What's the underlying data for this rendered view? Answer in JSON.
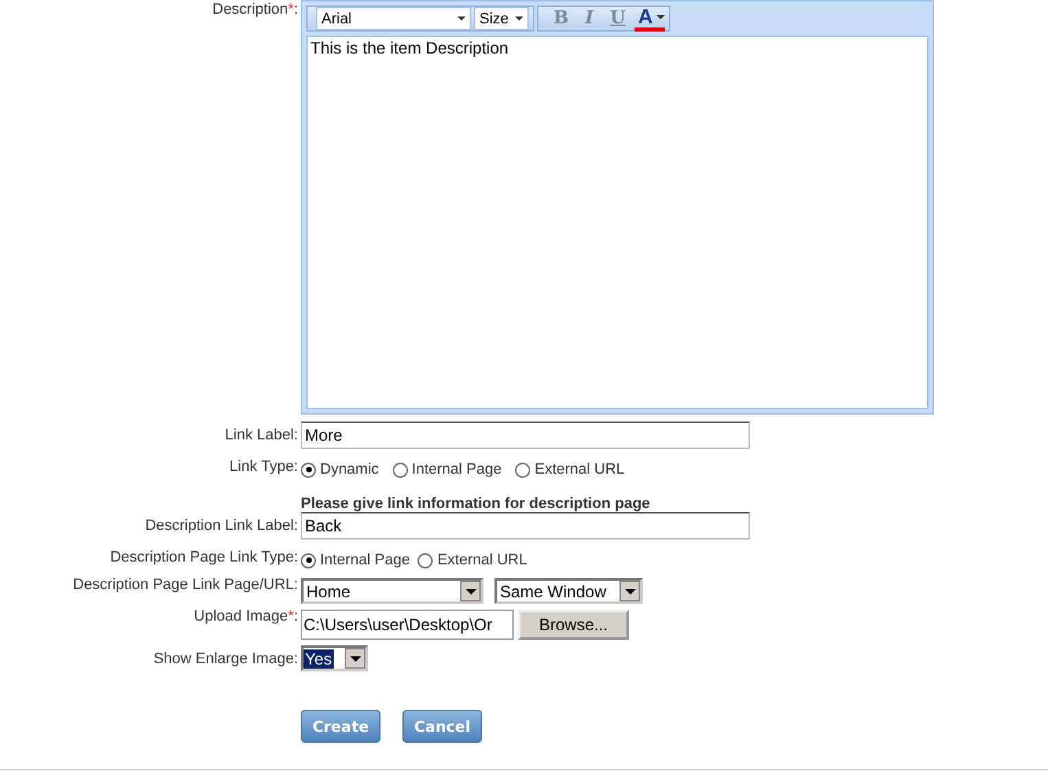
{
  "description": {
    "label": "Description",
    "required_mark": "*",
    "colon": ":",
    "font": "Arial",
    "size": "Size",
    "format_buttons": [
      {
        "kind": "bold",
        "label": "B"
      },
      {
        "kind": "italic",
        "label": "I"
      },
      {
        "kind": "underline",
        "label": "U"
      },
      {
        "kind": "color",
        "label": "A"
      }
    ],
    "text": "This is the item Description"
  },
  "link_label": {
    "label": "Link Label:",
    "value": "More"
  },
  "link_type": {
    "label": "Link Type:",
    "options": [
      {
        "label": "Dynamic",
        "selected": true
      },
      {
        "label": "Internal Page",
        "selected": false
      },
      {
        "label": "External URL",
        "selected": false
      }
    ]
  },
  "section_heading": "Please give link information for description page",
  "description_link_label": {
    "label": "Description Link Label:",
    "value": "Back"
  },
  "description_page_link_type": {
    "label": "Description Page Link Type:",
    "options": [
      {
        "label": "Internal Page",
        "selected": true
      },
      {
        "label": "External URL",
        "selected": false
      }
    ]
  },
  "description_page_link": {
    "label": "Description Page Link Page/URL:",
    "page": "Home",
    "target": "Same Window"
  },
  "upload_image": {
    "label": "Upload Image",
    "required_mark": "*",
    "colon": ":",
    "value": "C:\\Users\\user\\Desktop\\Or",
    "button": "Browse..."
  },
  "show_enlarge_image": {
    "label": "Show Enlarge Image:",
    "value": "Yes"
  },
  "buttons": [
    "Create",
    "Cancel"
  ]
}
